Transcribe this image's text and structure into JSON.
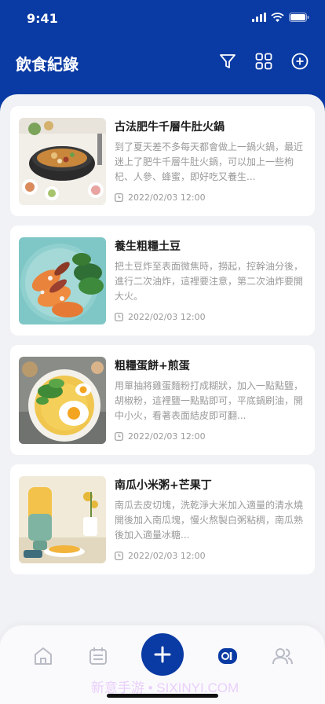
{
  "status": {
    "time": "9:41"
  },
  "header": {
    "title": "飲食紀錄"
  },
  "records": [
    {
      "title": "古法肥牛千層牛肚火鍋",
      "description": "到了夏天差不多每天都會做上一鍋火鍋，最近迷上了肥牛千層牛肚火鍋，可以加上一些枸杞、人參、蜂蜜，即好吃又養生...",
      "datetime": "2022/02/03 12:00"
    },
    {
      "title": "養生粗糧土豆",
      "description": "把土豆炸至表面微焦時，撈起，控幹油分後，進行二次油炸，這裡要注意，第二次油炸要開大火。",
      "datetime": "2022/02/03 12:00"
    },
    {
      "title": "粗糧蛋餅+煎蛋",
      "description": "用單抽將雞蛋麵粉打成糊狀，加入一點點鹽，胡椒粉，這裡鹽一點點即可，平底鍋刷油，開中小火，看著表面結皮即可翻...",
      "datetime": "2022/02/03 12:00"
    },
    {
      "title": "南瓜小米粥+芒果丁",
      "description": "南瓜去皮切塊，洗乾淨大米加入適量的清水燒開後加入南瓜塊，慢火熬製白粥粘稠，南瓜熟後加入適量冰糖...",
      "datetime": "2022/02/03 12:00"
    }
  ],
  "tabbar": {
    "items": [
      "home-icon",
      "calendar-icon",
      "add-icon",
      "record-icon",
      "users-icon"
    ]
  },
  "watermark": "新意手游 • SIXINYI.COM",
  "colors": {
    "primary": "#0a3aa3",
    "background": "#f1f2f5",
    "muted_text": "#9a9a9a"
  }
}
